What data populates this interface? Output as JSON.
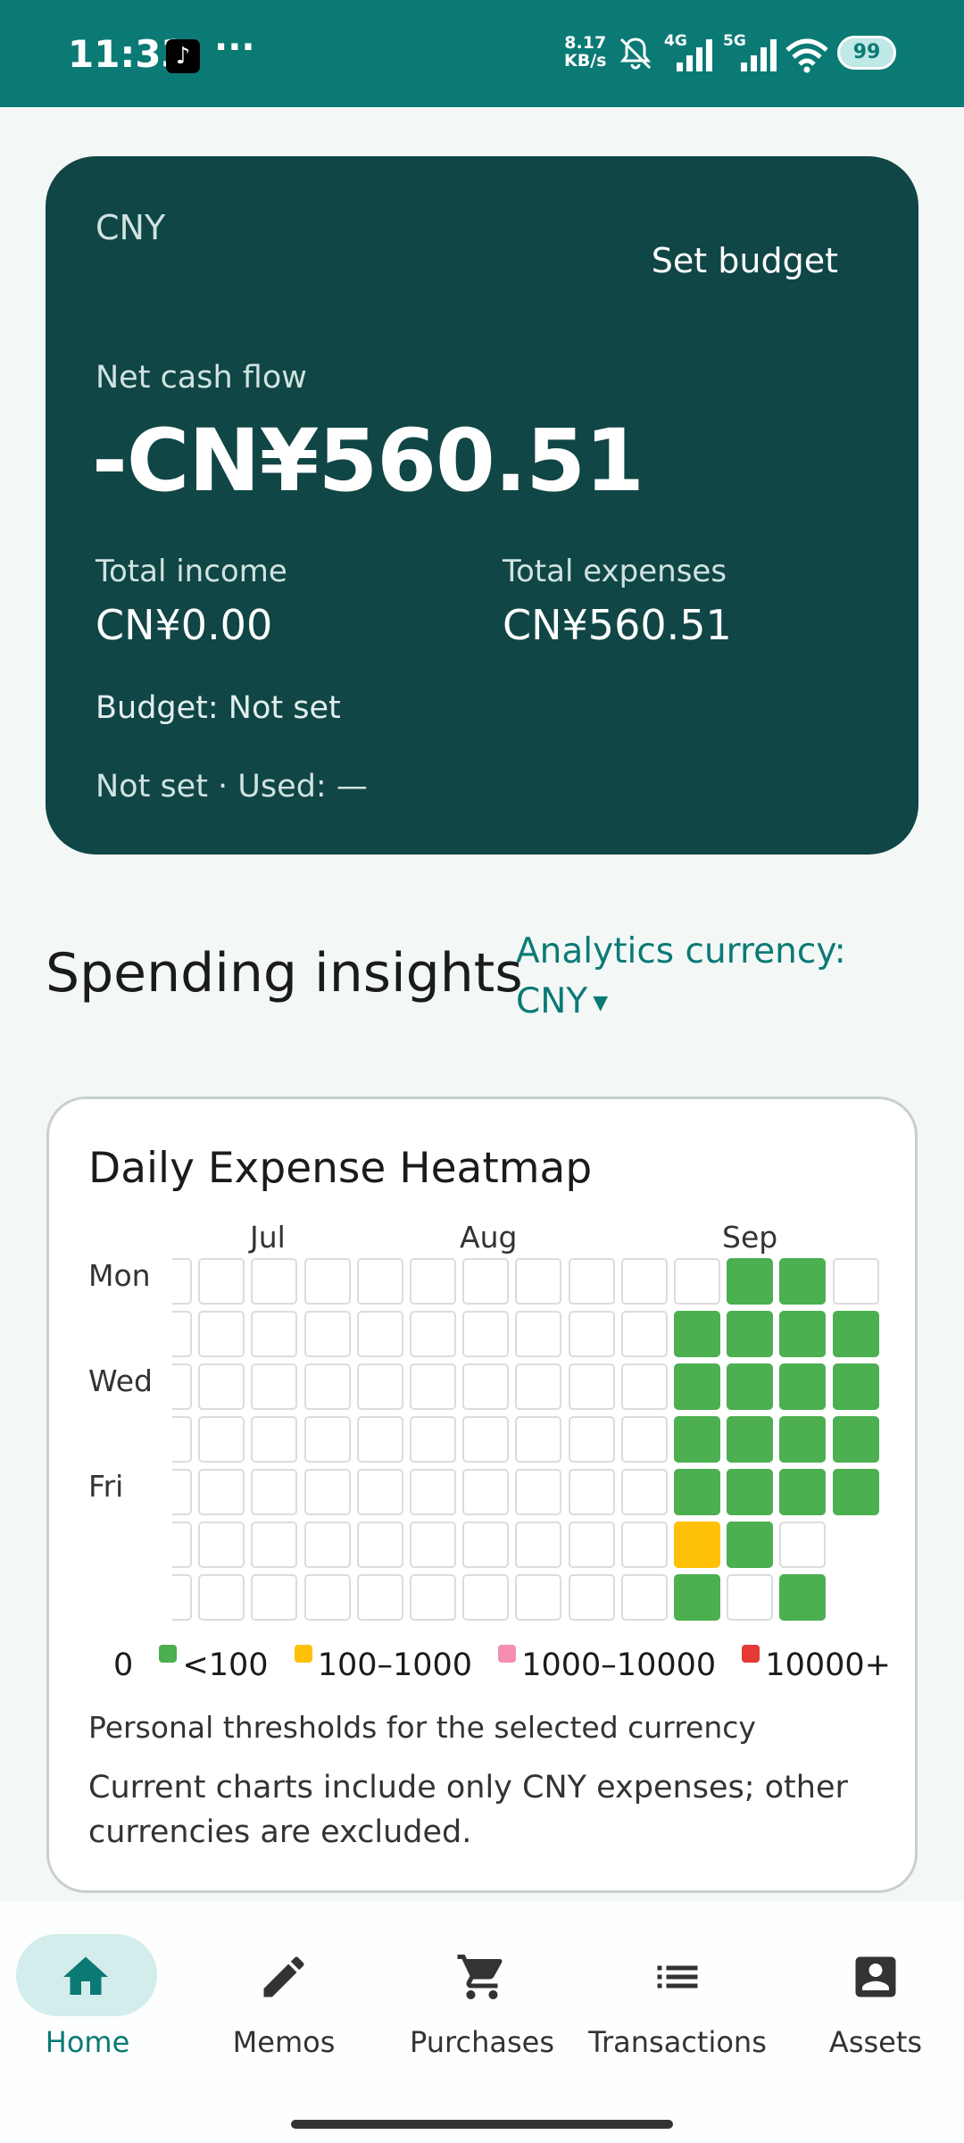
{
  "status_bar": {
    "time": "11:33",
    "dots": "···",
    "speed_value": "8.17",
    "speed_unit": "KB/s",
    "net1": "4G",
    "net2": "5G",
    "battery": "99"
  },
  "summary": {
    "currency": "CNY",
    "set_budget": "Set budget",
    "net_label": "Net cash flow",
    "net_value": "-CN¥560.51",
    "income_label": "Total income",
    "income_value": "CN¥0.00",
    "expenses_label": "Total expenses",
    "expenses_value": "CN¥560.51",
    "budget_text": "Budget: Not set",
    "used_text": "Not set · Used: —"
  },
  "insights": {
    "title": "Spending insights",
    "analytics_line1": "Analytics currency:",
    "analytics_line2": "CNY"
  },
  "heatmap": {
    "title": "Daily Expense Heatmap",
    "months": [
      "Jul",
      "Aug",
      "Sep"
    ],
    "day_labels": [
      "Mon",
      "Wed",
      "Fri"
    ],
    "levels_by_row": [
      [
        0,
        0,
        0,
        0,
        0,
        0,
        0,
        0,
        0,
        0,
        0,
        1,
        1,
        0
      ],
      [
        0,
        0,
        0,
        0,
        0,
        0,
        0,
        0,
        0,
        0,
        1,
        1,
        1,
        1
      ],
      [
        0,
        0,
        0,
        0,
        0,
        0,
        0,
        0,
        0,
        0,
        1,
        1,
        1,
        1
      ],
      [
        0,
        0,
        0,
        0,
        0,
        0,
        0,
        0,
        0,
        0,
        1,
        1,
        1,
        1
      ],
      [
        0,
        0,
        0,
        0,
        0,
        0,
        0,
        0,
        0,
        0,
        1,
        1,
        1,
        1
      ],
      [
        0,
        0,
        0,
        0,
        0,
        0,
        0,
        0,
        0,
        0,
        2,
        1,
        0,
        -1
      ],
      [
        0,
        0,
        0,
        0,
        0,
        0,
        0,
        0,
        0,
        0,
        1,
        0,
        1,
        -1
      ]
    ],
    "legend": {
      "zero": "0",
      "l1": "<100",
      "l2": "100–1000",
      "l3": "1000–10000",
      "l4": "10000+"
    },
    "colors": {
      "l1": "#4CAF50",
      "l2": "#FFC107",
      "l3": "#F48FB1",
      "l4": "#E53935"
    },
    "note1": "Personal thresholds for the selected currency",
    "note2": "Current charts include only CNY expenses; other currencies are excluded."
  },
  "nav": {
    "items": [
      {
        "label": "Home",
        "icon": "home-icon"
      },
      {
        "label": "Memos",
        "icon": "pencil-icon"
      },
      {
        "label": "Purchases",
        "icon": "cart-icon"
      },
      {
        "label": "Transactions",
        "icon": "list-icon"
      },
      {
        "label": "Assets",
        "icon": "account-box-icon"
      }
    ]
  }
}
